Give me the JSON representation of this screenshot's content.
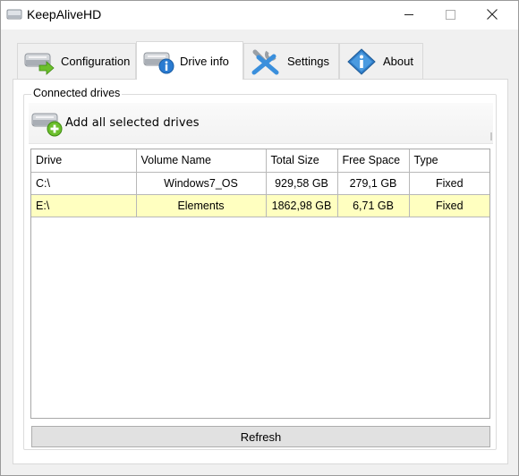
{
  "window": {
    "title": "KeepAliveHD",
    "icon": "drive-icon",
    "controls": {
      "minimize": "minimize-icon",
      "maximize": "maximize-icon",
      "close": "close-icon"
    }
  },
  "tabs": [
    {
      "label": "Configuration",
      "icon": "drive-arrow-icon",
      "selected": false
    },
    {
      "label": "Drive info",
      "icon": "drive-info-icon",
      "selected": true
    },
    {
      "label": "Settings",
      "icon": "tools-icon",
      "selected": false
    },
    {
      "label": "About",
      "icon": "about-info-icon",
      "selected": false
    }
  ],
  "drive_info": {
    "group_title": "Connected drives",
    "toolbar": {
      "add_label": "Add all selected drives",
      "add_icon": "drive-add-icon"
    },
    "table": {
      "columns": [
        "Drive",
        "Volume Name",
        "Total Size",
        "Free Space",
        "Type"
      ],
      "rows": [
        {
          "drive": "C:\\",
          "volume": "Windows7_OS",
          "total": "929,58 GB",
          "free": "279,1 GB",
          "type": "Fixed",
          "selected": false
        },
        {
          "drive": "E:\\",
          "volume": "Elements",
          "total": "1862,98 GB",
          "free": "6,71 GB",
          "type": "Fixed",
          "selected": true
        }
      ]
    },
    "refresh_label": "Refresh"
  },
  "colors": {
    "selected_row": "#ffffc0",
    "button_face": "#e1e1e1",
    "window_bg": "#f0f0f0"
  }
}
